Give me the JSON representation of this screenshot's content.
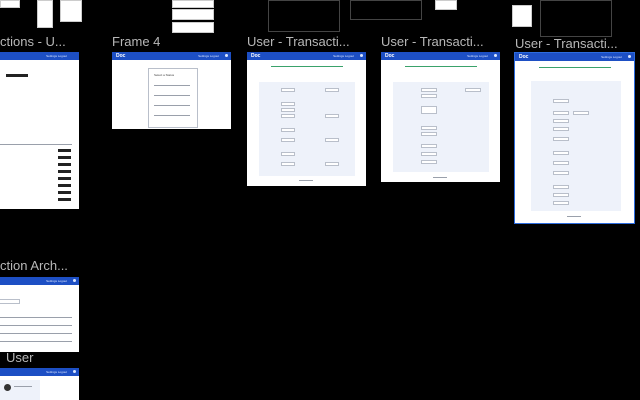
{
  "canvas": {
    "background": "#000000",
    "accent": "#1d4fc4",
    "selection": "#2d6cdf"
  },
  "frames": [
    {
      "id": "f1",
      "label": "ctions - U..."
    },
    {
      "id": "f2",
      "label": "Frame 4"
    },
    {
      "id": "f3",
      "label": "User - Transacti..."
    },
    {
      "id": "f4",
      "label": "User - Transacti..."
    },
    {
      "id": "f5",
      "label": "User - Transacti..."
    },
    {
      "id": "f6",
      "label": "ction Arch..."
    },
    {
      "id": "f7",
      "label": "User"
    }
  ],
  "app": {
    "logo": "Doc",
    "nav_text": "Settings  Logout"
  },
  "frame4": {
    "card_title": "Select a Status"
  }
}
